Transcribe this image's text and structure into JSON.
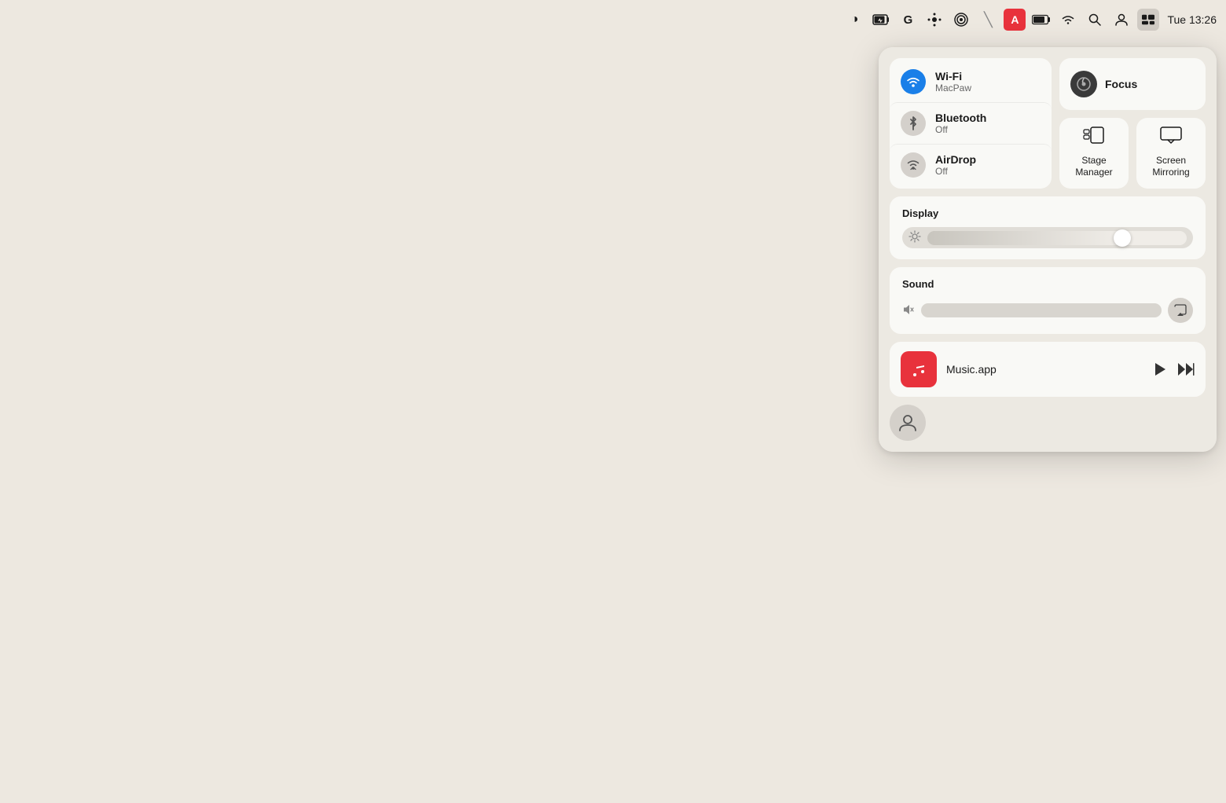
{
  "menubar": {
    "time": "Tue 13:26",
    "icons": [
      {
        "name": "halflife-icon",
        "symbol": "◑"
      },
      {
        "name": "battery-charging-icon",
        "symbol": "🔋"
      },
      {
        "name": "grammarly-icon",
        "symbol": "G"
      },
      {
        "name": "setapp-icon",
        "symbol": "✦"
      },
      {
        "name": "screenrecorder-icon",
        "symbol": "⌾"
      },
      {
        "name": "scrubber-icon",
        "symbol": "╱"
      },
      {
        "name": "typeface-icon",
        "symbol": "A"
      },
      {
        "name": "battery2-icon",
        "symbol": "⚡"
      },
      {
        "name": "wifi-menubar-icon",
        "symbol": "wifi"
      },
      {
        "name": "search-icon",
        "symbol": "🔍"
      },
      {
        "name": "user-icon",
        "symbol": "👤"
      },
      {
        "name": "control-center-icon",
        "symbol": "⊞"
      }
    ]
  },
  "control_center": {
    "connectivity": {
      "wifi": {
        "label": "Wi-Fi",
        "subtitle": "MacPaw",
        "active": true
      },
      "bluetooth": {
        "label": "Bluetooth",
        "subtitle": "Off",
        "active": false
      },
      "airdrop": {
        "label": "AirDrop",
        "subtitle": "Off",
        "active": false
      }
    },
    "focus": {
      "label": "Focus"
    },
    "stage_manager": {
      "label": "Stage Manager"
    },
    "screen_mirroring": {
      "label": "Screen Mirroring"
    },
    "display": {
      "label": "Display",
      "brightness": 75
    },
    "sound": {
      "label": "Sound",
      "volume": 0
    },
    "music": {
      "app": "Music.app"
    },
    "user_button": {
      "label": "User"
    }
  }
}
